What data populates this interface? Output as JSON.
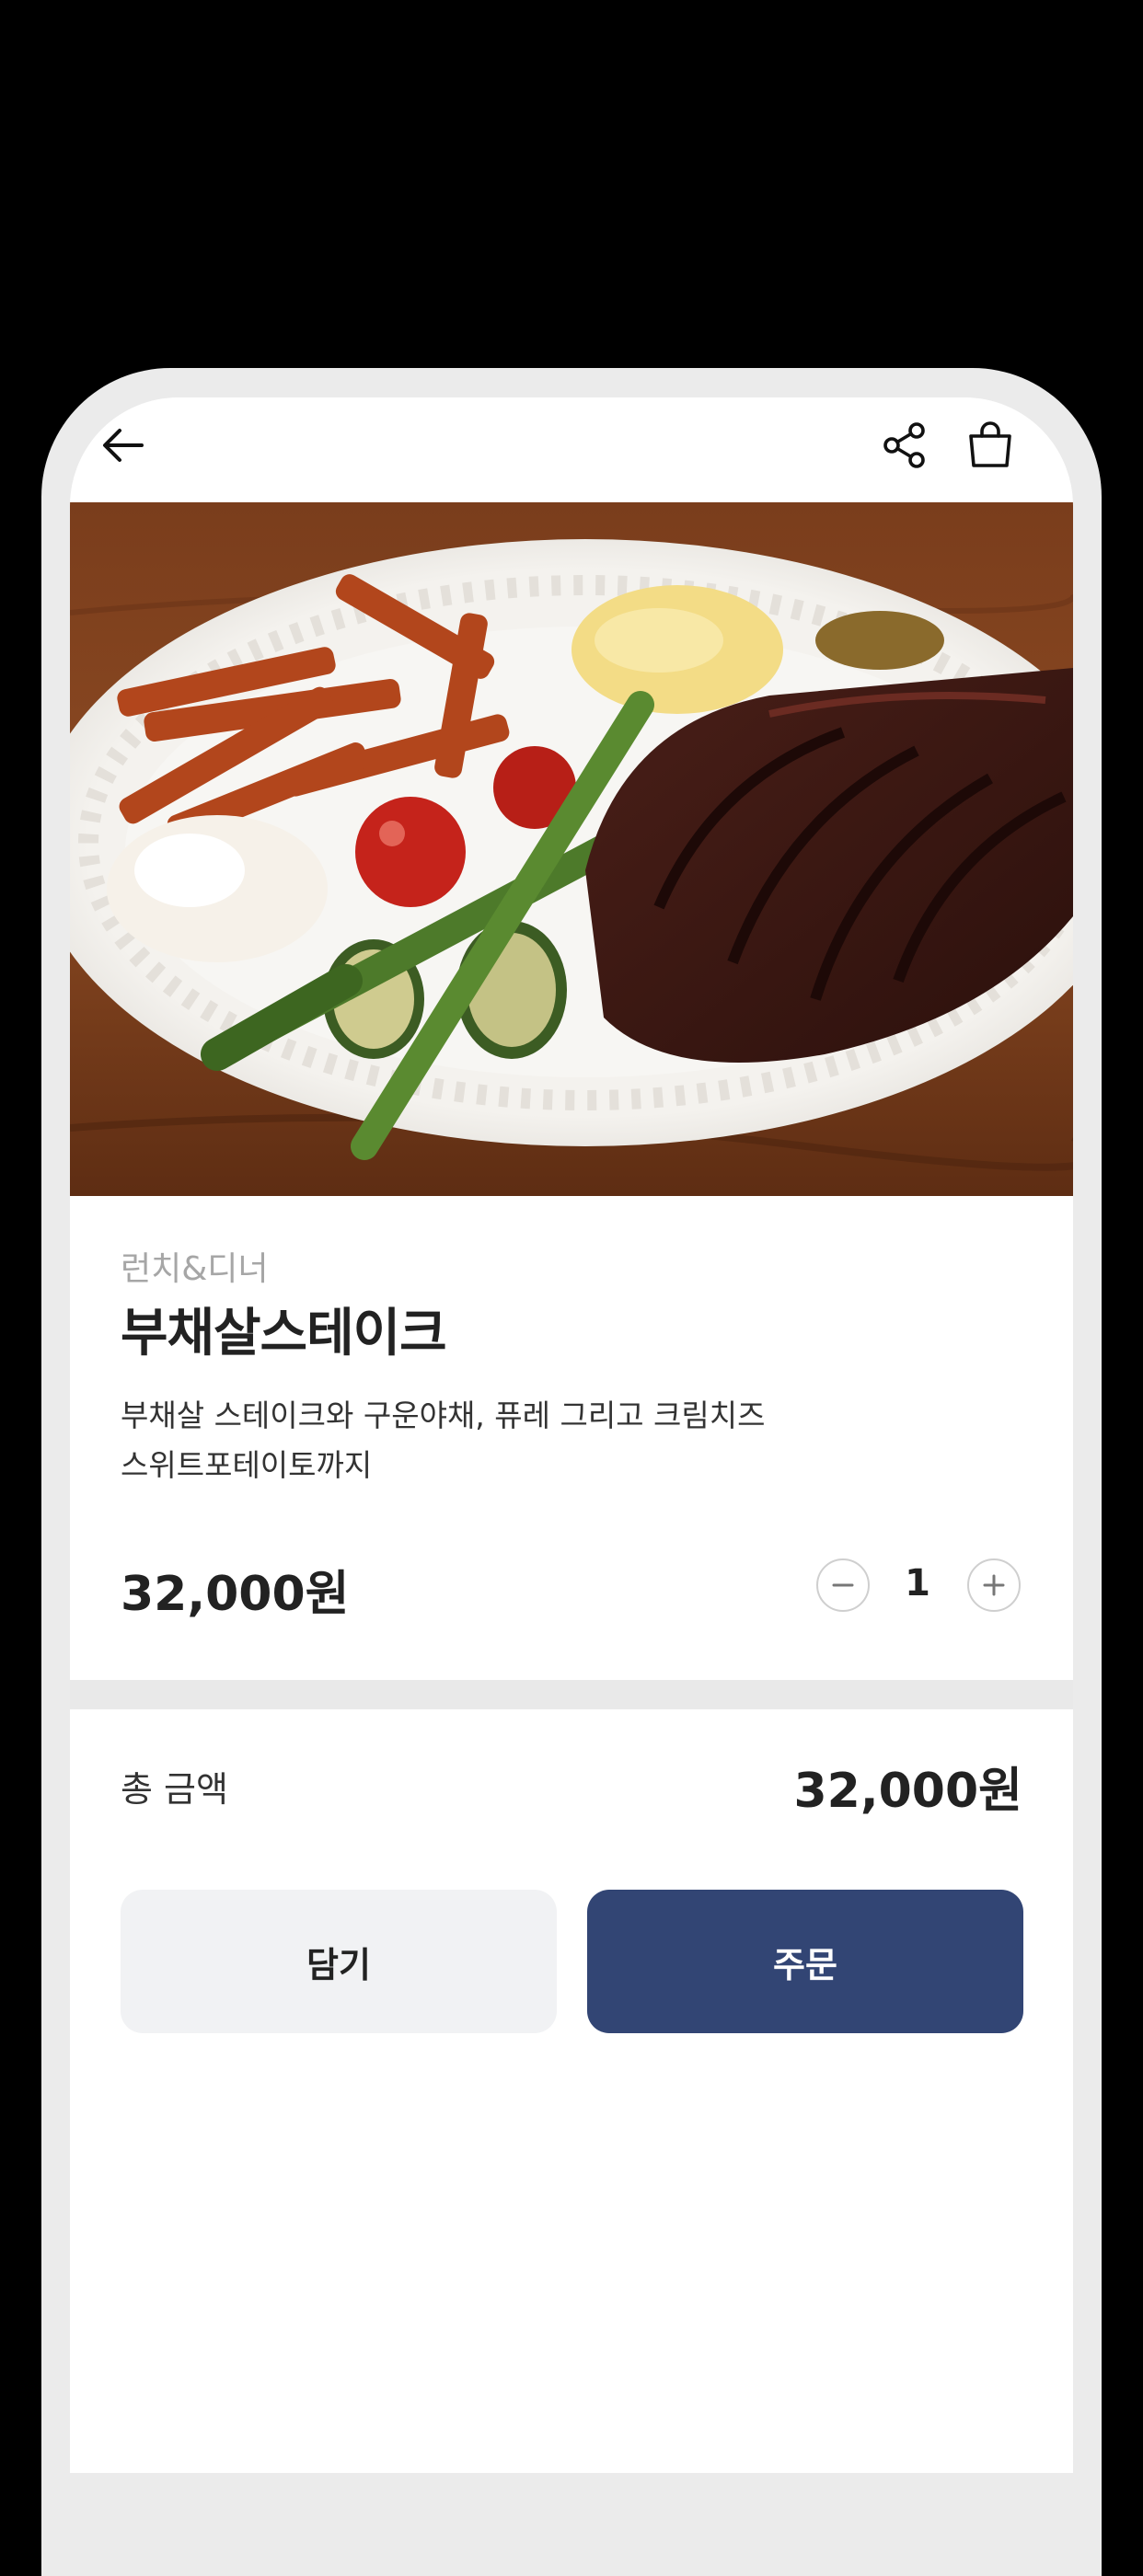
{
  "header": {
    "back_icon": "arrow-left-icon",
    "share_icon": "share-icon",
    "cart_icon": "shopping-bag-icon"
  },
  "hero_image": {
    "description_icon": "steak-plate-photo"
  },
  "product": {
    "category": "런치&디너",
    "name": "부채살스테이크",
    "description_line1": "부채살 스테이크와 구운야채, 퓨레 그리고 크림치즈",
    "description_line2": "스위트포테이토까지",
    "price": "32,000원",
    "quantity": "1"
  },
  "total": {
    "label": "총 금액",
    "value": "32,000원"
  },
  "actions": {
    "add_to_cart_label": "담기",
    "order_label": "주문"
  },
  "colors": {
    "background": "#000000",
    "frame": "#ebebeb",
    "primary": "#324574",
    "secondary_button": "#f1f2f4",
    "divider": "#e9e9e9",
    "muted_text": "#a6a6a6"
  }
}
